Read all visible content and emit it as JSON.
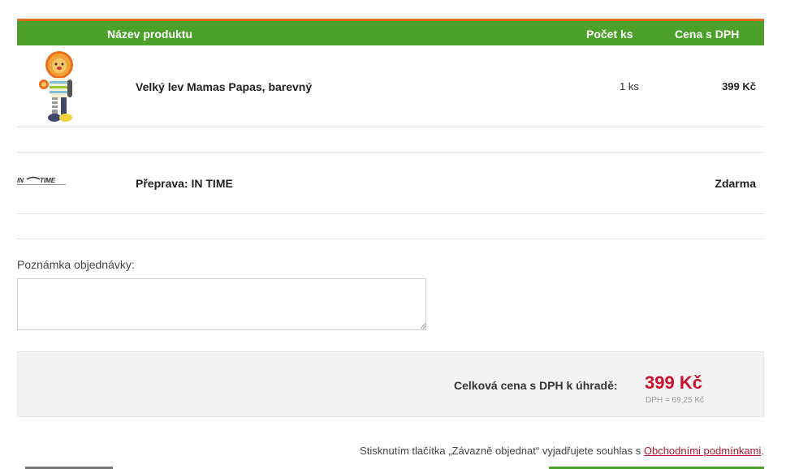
{
  "table": {
    "headers": {
      "name": "Název produktu",
      "qty": "Počet ks",
      "price": "Cena s DPH"
    },
    "items": [
      {
        "name": "Velký lev Mamas Papas, barevný",
        "qty": "1 ks",
        "price": "399 Kč",
        "image_icon": "lion-plush-toy"
      }
    ],
    "shipping": {
      "name": "Přeprava: IN TIME",
      "price": "Zdarma",
      "logo_icon": "in-time-logo"
    }
  },
  "note": {
    "label": "Poznámka objednávky:",
    "value": ""
  },
  "total": {
    "label": "Celková cena s DPH k úhradě:",
    "price": "399 Kč",
    "vat": "DPH = 69,25 Kč"
  },
  "terms": {
    "text": "Stisknutím tlačítka „Závazně objednat“ vyjadřujete souhlas s",
    "link": "Obchodními podmínkami",
    "end": "."
  },
  "colors": {
    "header_green": "#4ca12a",
    "accent_orange": "#e36b23",
    "price_red": "#c8102e"
  }
}
